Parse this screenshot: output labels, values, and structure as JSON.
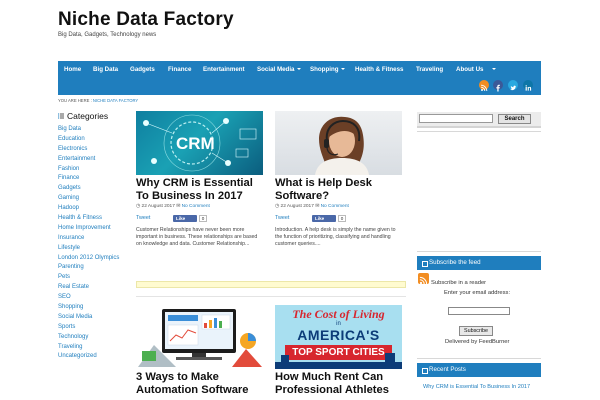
{
  "site": {
    "title": "Niche Data Factory",
    "tagline": "Big Data, Gadgets, Technology news"
  },
  "nav": {
    "items": [
      {
        "label": "Home",
        "has_submenu": false
      },
      {
        "label": "Big Data",
        "has_submenu": false
      },
      {
        "label": "Gadgets",
        "has_submenu": false
      },
      {
        "label": "Finance",
        "has_submenu": false
      },
      {
        "label": "Entertainment",
        "has_submenu": false
      },
      {
        "label": "Social Media",
        "has_submenu": true
      },
      {
        "label": "Shopping",
        "has_submenu": true
      },
      {
        "label": "Health & Fitness",
        "has_submenu": false
      },
      {
        "label": "Traveling",
        "has_submenu": false
      },
      {
        "label": "About Us",
        "has_submenu": true
      }
    ],
    "social_icons": [
      "rss-icon",
      "facebook-icon",
      "twitter-icon",
      "linkedin-icon"
    ]
  },
  "breadcrumb": {
    "prefix": "YOU ARE HERE :",
    "current": "NICHE DATA FACTORY"
  },
  "categories": {
    "heading": "Categories",
    "items": [
      "Big Data",
      "Education",
      "Electronics",
      "Entertainment",
      "Fashion",
      "Finance",
      "Gadgets",
      "Gaming",
      "Hadoop",
      "Health & Fitness",
      "Home Improvement",
      "Insurance",
      "Lifestyle",
      "London 2012 Olympics",
      "Parenting",
      "Pets",
      "Real Estate",
      "SEO",
      "Shopping",
      "Social Media",
      "Sports",
      "Technology",
      "Traveling",
      "Uncategorized"
    ]
  },
  "posts": [
    {
      "title": "Why CRM is Essential To Business In 2017",
      "date": "22 August 2017",
      "comments": "No Comment",
      "tweet": "Tweet",
      "like": "Like",
      "like_count": "0",
      "excerpt": "Customer Relationships have never been more important in business. These relationships are based on knowledge and data. Customer Relationship...",
      "thumb_text": "CRM"
    },
    {
      "title": "What is Help Desk Software?",
      "date": "22 August 2017",
      "comments": "No Comment",
      "tweet": "Tweet",
      "like": "Like",
      "like_count": "0",
      "excerpt": "Introduction. A help desk is simply the name given to the function of prioritizing, classifying and handling customer queries...."
    },
    {
      "title": "3 Ways to Make Automation Software"
    },
    {
      "title": "How Much Rent Can Professional Athletes",
      "thumb_lines": [
        "The Cost of Living",
        "in",
        "AMERICA'S",
        "TOP SPORT CITIES"
      ]
    }
  ],
  "sidebar": {
    "search_placeholder": "",
    "search_button": "Search",
    "subscribe": {
      "heading": "Subscribe the feed",
      "reader_text": "Subscribe in a reader",
      "email_label": "Enter your email address:",
      "button": "Subscribe",
      "delivered_by": "Delivered by FeedBurner"
    },
    "recent": {
      "heading": "Recent Posts",
      "items": [
        "Why CRM is Essential To Business In 2017"
      ]
    }
  },
  "colors": {
    "nav_blue": "#1f7ebe",
    "link_blue": "#1f7ebe",
    "rss_orange": "#f28d22",
    "facebook_blue": "#3b5998",
    "twitter_blue": "#2aa9e0",
    "linkedin_blue": "#0e76a8"
  }
}
